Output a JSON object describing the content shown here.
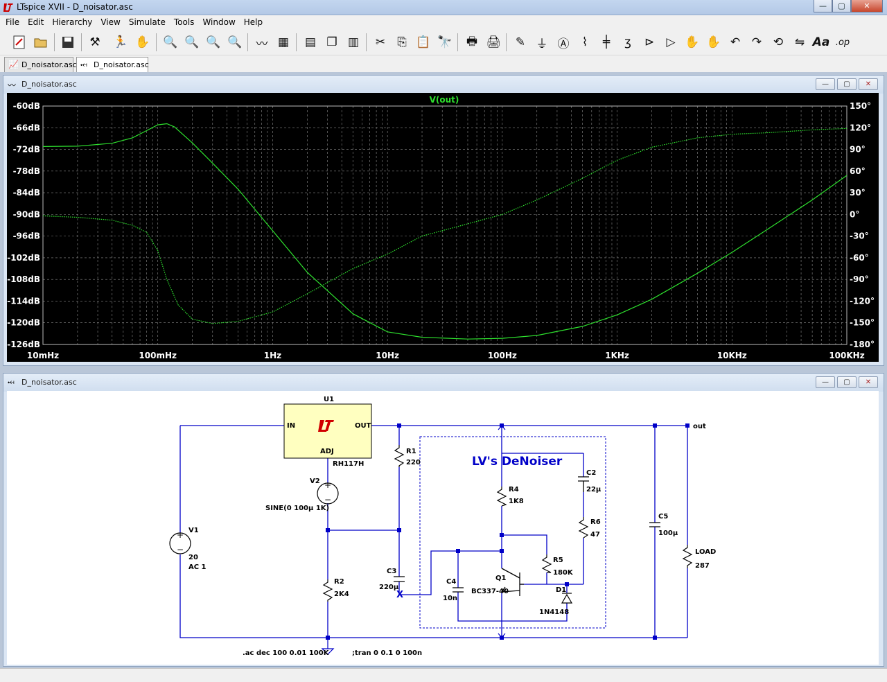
{
  "window": {
    "title": "LTspice XVII - D_noisator.asc",
    "min": "—",
    "max": "▢",
    "close": "✕"
  },
  "menu": [
    "File",
    "Edit",
    "Hierarchy",
    "View",
    "Simulate",
    "Tools",
    "Window",
    "Help"
  ],
  "toolbar": {
    "icons": [
      "new-schematic-icon",
      "open-icon",
      "save-icon",
      "control-panel-icon",
      "run-icon",
      "halt-icon",
      "zoom-in-icon",
      "zoom-full-icon",
      "zoom-out-icon",
      "zoom-cancel-icon",
      "autorange-icon",
      "view-fft-icon",
      "tile-horizontal-icon",
      "cascade-icon",
      "tile-vertical-icon",
      "cut-icon",
      "copy-icon",
      "paste-icon",
      "find-icon",
      "print-icon",
      "print-setup-icon",
      "draw-wire-icon",
      "ground-icon",
      "label-net-icon",
      "resistor-icon",
      "capacitor-icon",
      "inductor-icon",
      "diode-icon",
      "component-icon",
      "move-icon",
      "drag-icon",
      "undo-icon",
      "redo-icon",
      "rotate-icon",
      "mirror-icon",
      "text-icon",
      "spice-directive-icon"
    ]
  },
  "tabs": [
    {
      "label": "D_noisator.asc",
      "icon": "waveform-icon"
    },
    {
      "label": "D_noisator.asc",
      "icon": "schematic-icon"
    }
  ],
  "plot_window": {
    "title": "D_noisator.asc",
    "min": "—",
    "max": "▢",
    "close": "✕"
  },
  "schematic_window": {
    "title": "D_noisator.asc",
    "min": "—",
    "max": "▢",
    "close": "✕"
  },
  "colors": {
    "trace": "#2ee02e",
    "plot_bg": "#000000",
    "axis_text": "#ffffff",
    "wire": "#0000c8",
    "grid": "#8c8c8c"
  },
  "chart_data": {
    "type": "line",
    "title": "V(out)",
    "xscale": "log",
    "xlim": [
      0.01,
      100000
    ],
    "x_ticks": [
      "10mHz",
      "100mHz",
      "1Hz",
      "10Hz",
      "100Hz",
      "1KHz",
      "10KHz",
      "100KHz"
    ],
    "ylim_left": [
      -126,
      -60
    ],
    "y_ticks_left": [
      "-60dB",
      "-66dB",
      "-72dB",
      "-78dB",
      "-84dB",
      "-90dB",
      "-96dB",
      "-102dB",
      "-108dB",
      "-114dB",
      "-120dB",
      "-126dB"
    ],
    "ylim_right": [
      -180,
      150
    ],
    "y_ticks_right": [
      "150°",
      "120°",
      "90°",
      "60°",
      "30°",
      "0°",
      "-30°",
      "-60°",
      "-90°",
      "-120°",
      "-150°",
      "-180°"
    ],
    "grid": true,
    "series": [
      {
        "axis": "left",
        "style": "solid",
        "x": [
          0.01,
          0.02,
          0.04,
          0.06,
          0.08,
          0.1,
          0.12,
          0.14,
          0.2,
          0.3,
          0.5,
          1,
          2,
          5,
          10,
          20,
          50,
          100,
          200,
          500,
          1000,
          2000,
          5000,
          10000,
          20000,
          50000,
          100000
        ],
        "y": [
          -71.2,
          -71.1,
          -70.3,
          -68.8,
          -66.8,
          -65.2,
          -64.9,
          -65.8,
          -70.2,
          -75.8,
          -83.0,
          -94.5,
          -106.0,
          -117.5,
          -122.5,
          -124.0,
          -124.5,
          -124.3,
          -123.5,
          -121.0,
          -117.8,
          -113.5,
          -106.3,
          -100.5,
          -94.3,
          -86.0,
          -79.2
        ]
      },
      {
        "axis": "right",
        "style": "dotted",
        "x": [
          0.01,
          0.02,
          0.04,
          0.06,
          0.08,
          0.1,
          0.12,
          0.15,
          0.2,
          0.3,
          0.5,
          1,
          2,
          5,
          10,
          20,
          50,
          100,
          200,
          500,
          1000,
          2000,
          5000,
          10000,
          20000,
          50000,
          100000
        ],
        "y": [
          -2,
          -4,
          -8,
          -15,
          -25,
          -50,
          -90,
          -125,
          -145,
          -151,
          -148,
          -135,
          -110,
          -75,
          -55,
          -30,
          -13,
          0,
          20,
          50,
          75,
          93,
          106,
          111,
          113,
          117,
          119
        ]
      }
    ]
  },
  "schematic": {
    "directives": [
      ".ac dec 100 0.01 100K",
      ";tran 0 0.1 0 100n"
    ],
    "box_title": "LV's DeNoiser",
    "net_out": "out",
    "u1": {
      "ref": "U1",
      "value": "RH117H",
      "pin_in": "IN",
      "pin_out": "OUT",
      "pin_adj": "ADJ"
    },
    "parts": [
      {
        "ref": "V1",
        "value": "20",
        "extra": "AC 1"
      },
      {
        "ref": "V2",
        "value": "SINE(0 100μ 1K)"
      },
      {
        "ref": "R1",
        "value": "220"
      },
      {
        "ref": "R2",
        "value": "2K4"
      },
      {
        "ref": "C3",
        "value": "220μ"
      },
      {
        "ref": "R4",
        "value": "1K8"
      },
      {
        "ref": "C2",
        "value": "22μ"
      },
      {
        "ref": "R6",
        "value": "47"
      },
      {
        "ref": "R5",
        "value": "180K"
      },
      {
        "ref": "C4",
        "value": "10n"
      },
      {
        "ref": "Q1",
        "value": "BC337-40"
      },
      {
        "ref": "D1",
        "value": "1N4148"
      },
      {
        "ref": "C5",
        "value": "100μ"
      },
      {
        "ref": "LOAD",
        "value": "287"
      }
    ]
  }
}
